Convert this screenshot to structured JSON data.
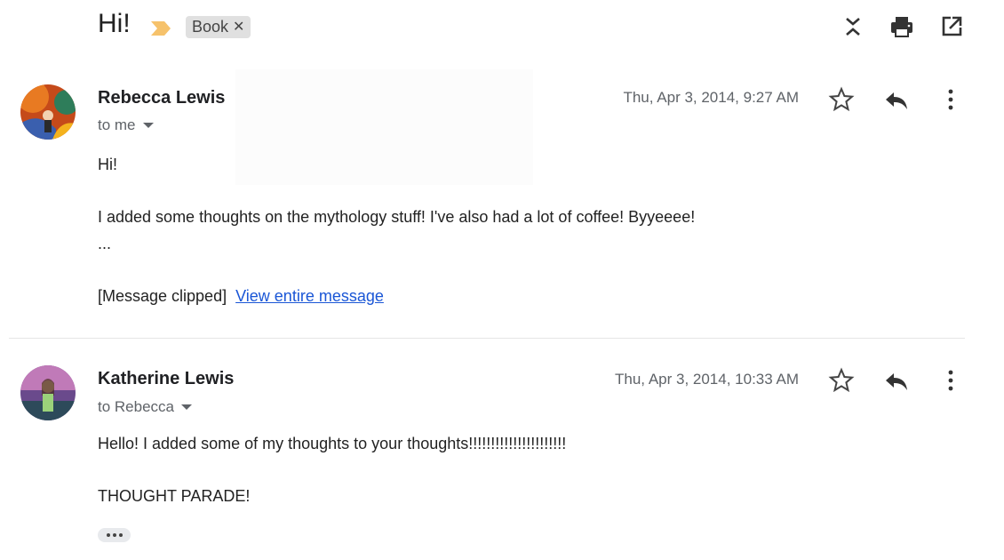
{
  "thread": {
    "subject": "Hi!",
    "label": "Book",
    "label_color": "#f6c26b"
  },
  "header_icons": [
    "expand-collapse-icon",
    "print-icon",
    "open-in-new-window-icon"
  ],
  "messages": [
    {
      "sender": "Rebecca Lewis",
      "recipient": "to me",
      "date": "Thu, Apr 3, 2014, 9:27 AM",
      "greeting": "Hi!",
      "body": "I added some thoughts on the mythology stuff! I've also had a lot of coffee! Byyeeee!",
      "ellipsis": "...",
      "clipped_note": "[Message clipped]",
      "view_link": "View entire message"
    },
    {
      "sender": "Katherine Lewis",
      "recipient": "to Rebecca",
      "date": "Thu, Apr 3, 2014, 10:33 AM",
      "body": "Hello! I added some of my thoughts to your thoughts!!!!!!!!!!!!!!!!!!!!!!",
      "body2": "THOUGHT PARADE!"
    }
  ],
  "colors": {
    "link": "#1a56d6",
    "muted": "#5f6368",
    "text": "#202124"
  }
}
